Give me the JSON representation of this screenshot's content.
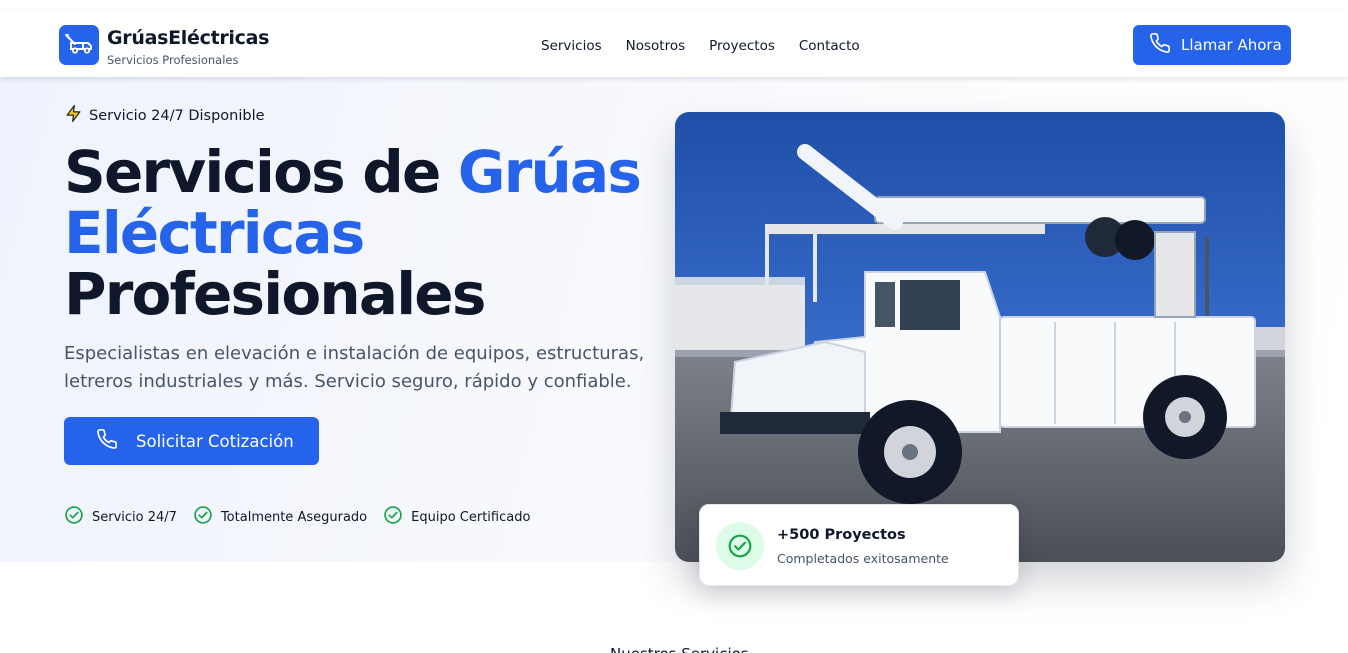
{
  "brand": {
    "name": "GrúasEléctricas",
    "subtitle": "Servicios Profesionales",
    "icon": "tow-truck-icon"
  },
  "nav": {
    "items": [
      "Servicios",
      "Nosotros",
      "Proyectos",
      "Contacto"
    ]
  },
  "header": {
    "call_label": "Llamar Ahora",
    "call_icon": "phone-icon"
  },
  "hero": {
    "availability": "Servicio 24/7 Disponible",
    "availability_icon": "lightning-icon",
    "title_part1": "Servicios de",
    "title_highlight1": "Grúas",
    "title_highlight2": "Eléctricas",
    "title_part2": "Profesionales",
    "description": "Especialistas en elevación e instalación de equipos, estructuras, letreros industriales y más. Servicio seguro, rápido y confiable.",
    "cta_label": "Solicitar Cotización",
    "cta_icon": "phone-icon",
    "features": [
      "Servicio 24/7",
      "Totalmente Asegurado",
      "Equipo Certificado"
    ],
    "feature_icon": "check-circle-icon"
  },
  "stats": {
    "title": "+500 Proyectos",
    "subtitle": "Completados exitosamente",
    "icon": "check-circle-icon"
  },
  "next_section": {
    "label": "Nuestros Servicios"
  },
  "colors": {
    "accent": "#2563eb",
    "text": "#0f172a",
    "muted": "#475569",
    "success": "#16a34a",
    "success_bg": "#dcfce7",
    "bolt": "#eab308"
  }
}
